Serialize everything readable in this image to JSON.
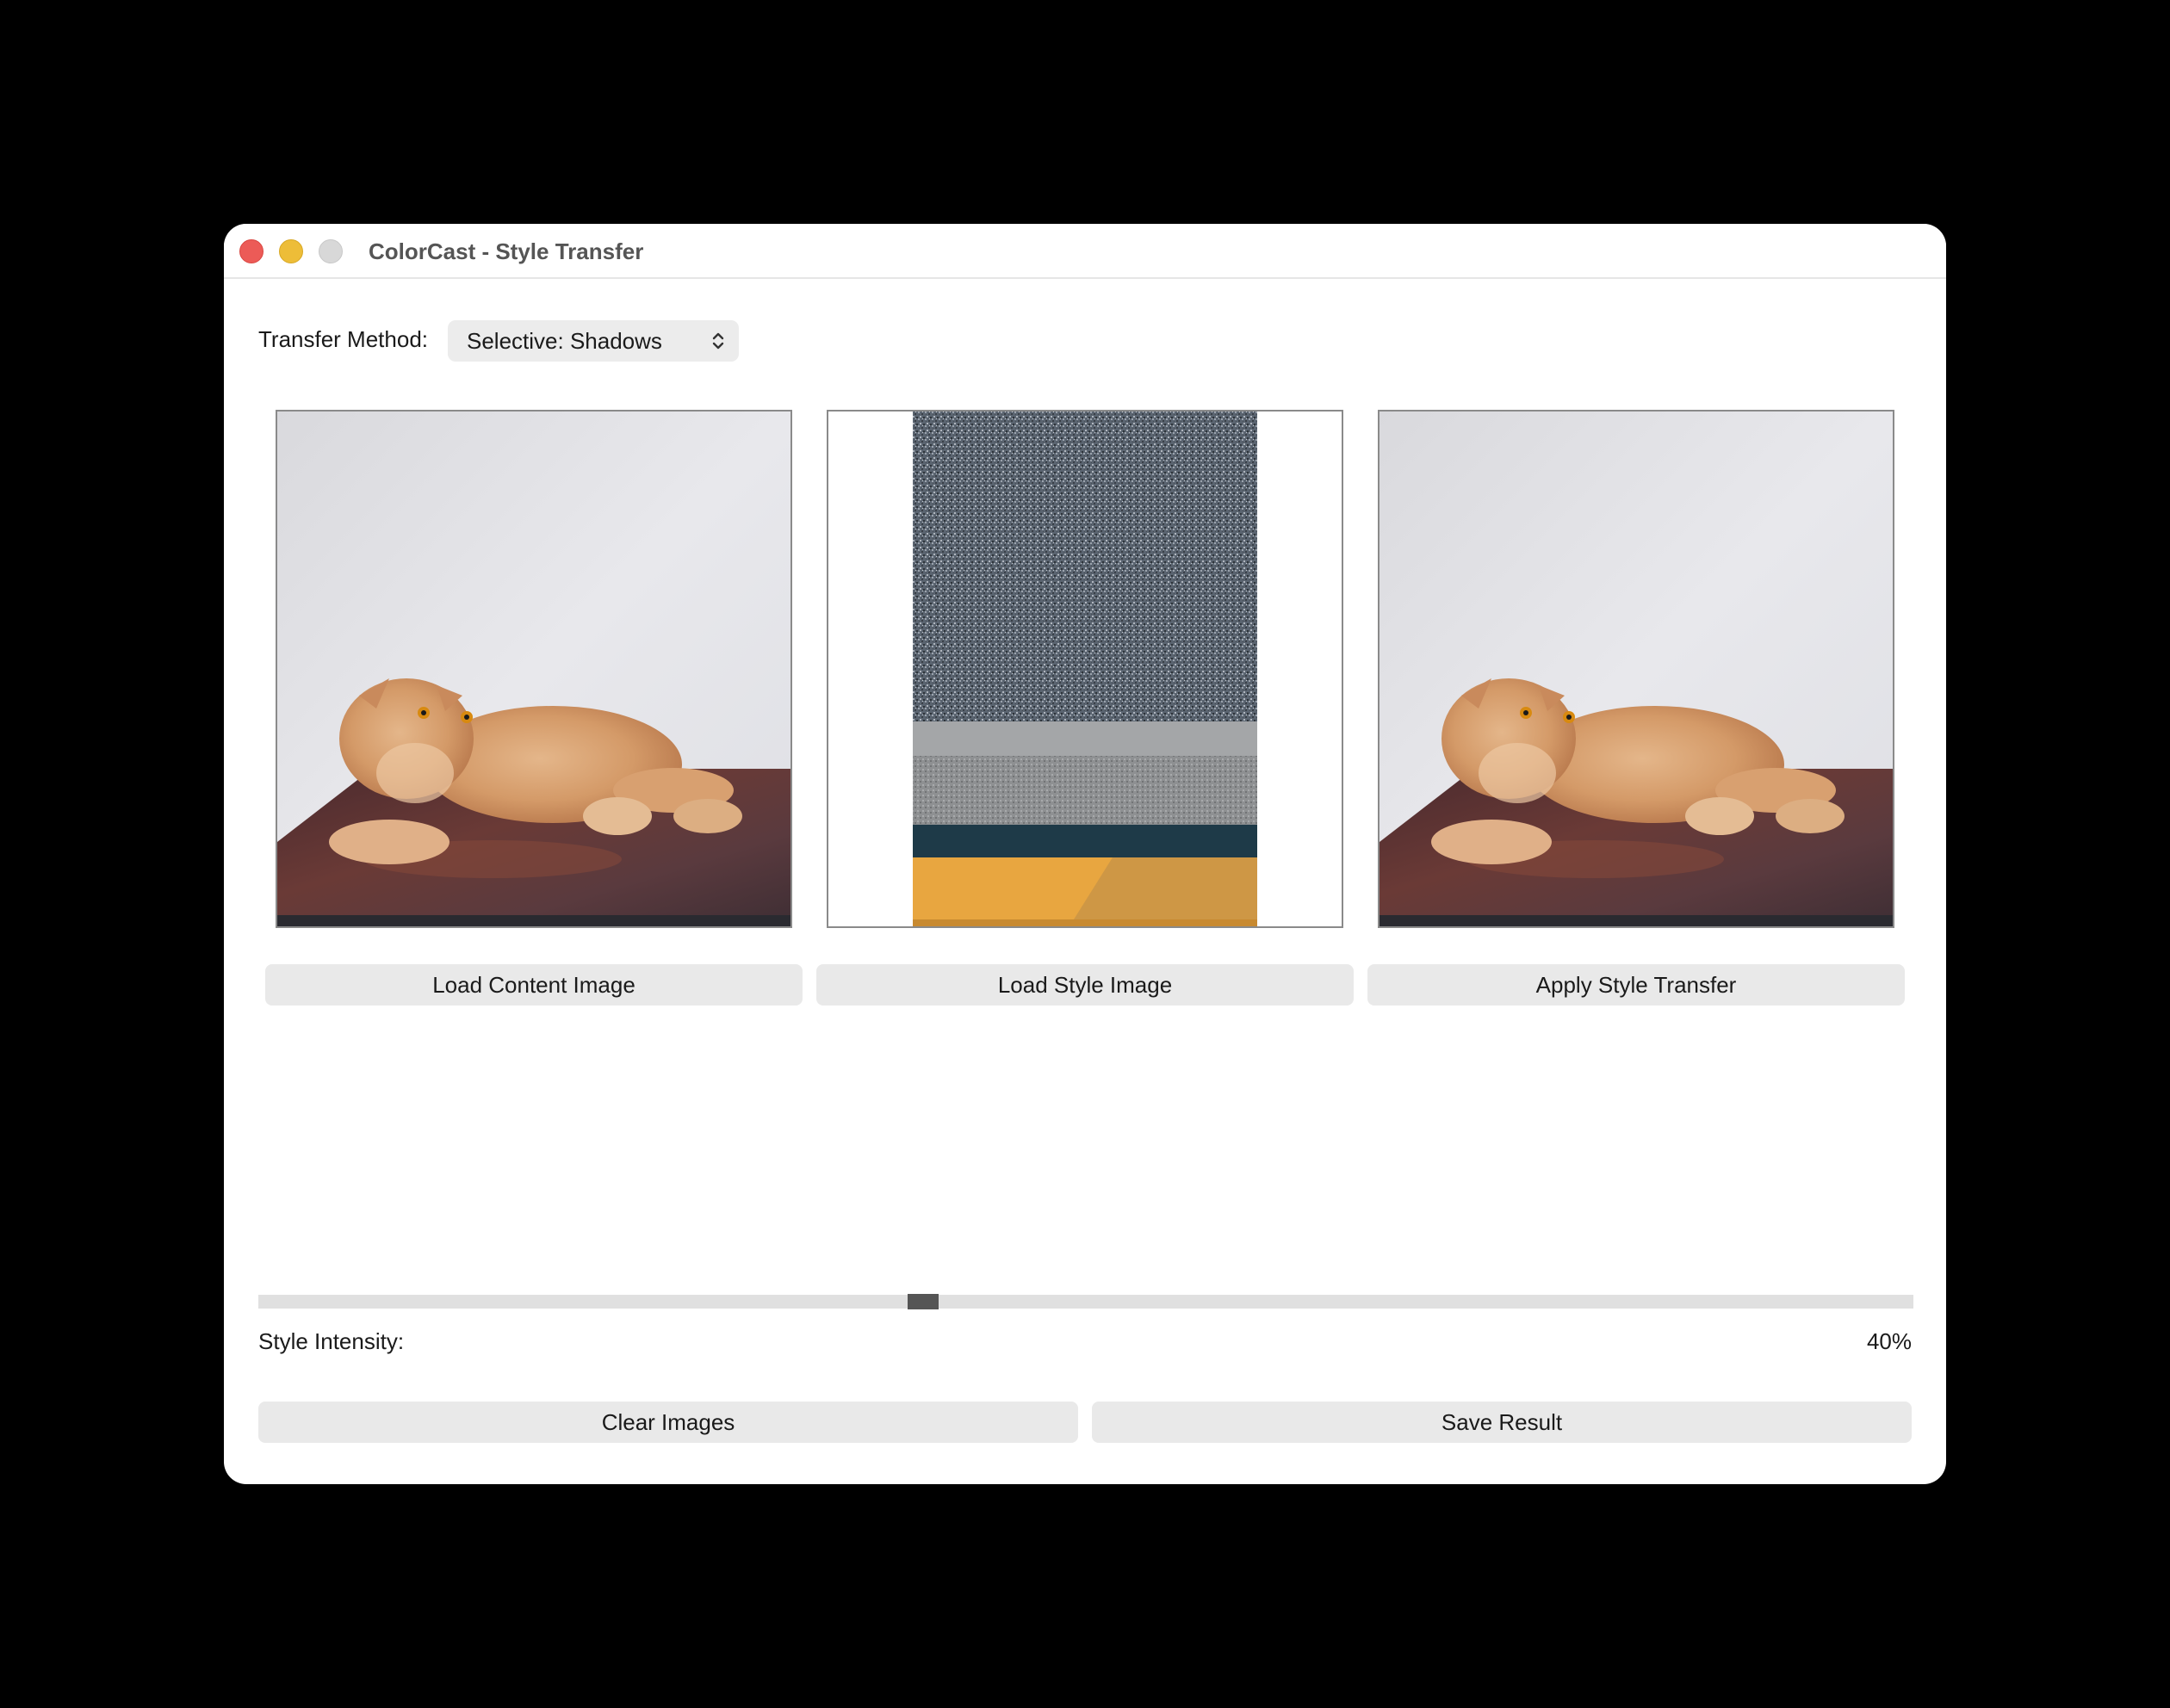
{
  "window": {
    "title": "ColorCast - Style Transfer"
  },
  "controls": {
    "transfer_method_label": "Transfer Method:",
    "transfer_method_value": "Selective: Shadows"
  },
  "images": {
    "content": {
      "icon": "cat-photo"
    },
    "style": {
      "icon": "concrete-texture-photo"
    },
    "result": {
      "icon": "cat-photo-styled"
    }
  },
  "buttons": {
    "load_content": "Load Content Image",
    "load_style": "Load Style Image",
    "apply": "Apply Style Transfer",
    "clear": "Clear Images",
    "save": "Save Result"
  },
  "intensity": {
    "label": "Style Intensity:",
    "value_text": "40%",
    "value": 0.4
  },
  "colors": {
    "close": "#ec5b57",
    "minimize": "#edbd38",
    "zoom": "#d8d8d8",
    "button_bg": "#e9e9e9",
    "slider_thumb": "#555555"
  }
}
